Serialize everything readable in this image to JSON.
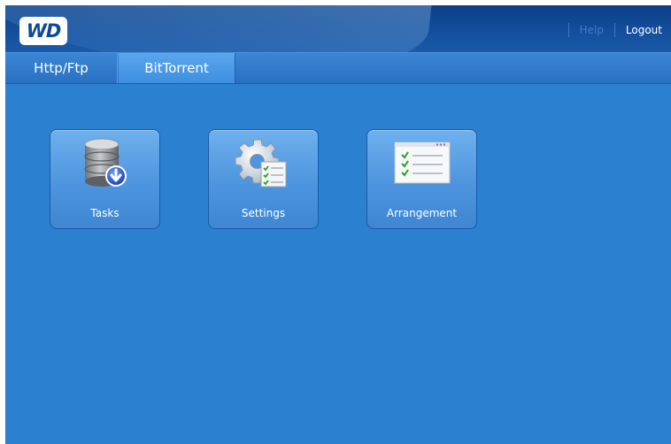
{
  "header": {
    "logo_text": "WD",
    "help_label": "Help",
    "logout_label": "Logout"
  },
  "tabs": [
    {
      "label": "Http/Ftp",
      "selected": false
    },
    {
      "label": "BitTorrent",
      "selected": true
    }
  ],
  "tiles": [
    {
      "label": "Tasks",
      "icon": "database-download-icon"
    },
    {
      "label": "Settings",
      "icon": "gear-checklist-icon"
    },
    {
      "label": "Arrangement",
      "icon": "checklist-icon"
    }
  ],
  "colors": {
    "background": "#2b81cf",
    "header": "#134e9c",
    "selected_tab": "#4b9be6",
    "help_link": "#3f7dc8",
    "logout_link": "#ffffff"
  }
}
